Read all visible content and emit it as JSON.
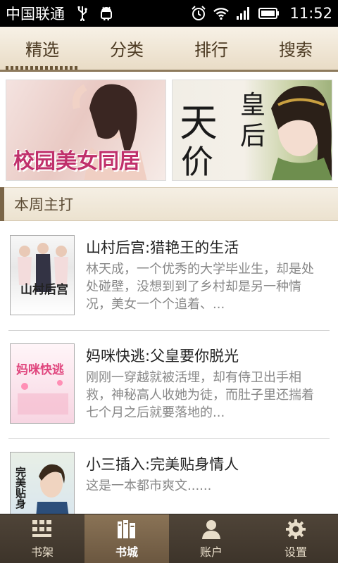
{
  "status_bar": {
    "carrier": "中国联通",
    "time": "11:52",
    "icons": [
      "usb-icon",
      "android-icon",
      "alarm-icon",
      "wifi-icon",
      "signal-icon",
      "battery-icon"
    ]
  },
  "top_tabs": [
    {
      "label": "精选",
      "active": true
    },
    {
      "label": "分类",
      "active": false
    },
    {
      "label": "排行",
      "active": false
    },
    {
      "label": "搜索",
      "active": false
    }
  ],
  "banners": [
    {
      "title": "校园美女同居"
    },
    {
      "title_chars": [
        "天",
        "价",
        "皇",
        "后"
      ]
    }
  ],
  "section": {
    "title": "本周主打"
  },
  "books": [
    {
      "title": "山村后宫:猎艳王的生活",
      "description": "林天成，一个优秀的大学毕业生，却是处处碰壁，没想到到了乡村却是另一种情况，美女一个个追着、...",
      "cover_text": "山村后宫"
    },
    {
      "title": "妈咪快逃:父皇要你脱光",
      "description": "刚刚一穿越就被活埋，却有侍卫出手相救，神秘高人收她为徒，而肚子里还揣着七个月之后就要落地的...",
      "cover_text": "妈咪快逃"
    },
    {
      "title": "小三插入:完美贴身情人",
      "description": "这是一本都市爽文......",
      "cover_text": "完美贴身"
    }
  ],
  "bottom_nav": [
    {
      "label": "书架",
      "icon": "grid-icon",
      "active": false
    },
    {
      "label": "书城",
      "icon": "books-icon",
      "active": true
    },
    {
      "label": "账户",
      "icon": "user-icon",
      "active": false
    },
    {
      "label": "设置",
      "icon": "gear-icon",
      "active": false
    }
  ],
  "colors": {
    "tab_bar_bg": "#efe5d3",
    "tab_text": "#4c3a22",
    "section_accent": "#7a6548",
    "bottom_nav_bg": "#453b30",
    "bottom_nav_active": "#7b664b",
    "banner_title": "#c0306b"
  }
}
